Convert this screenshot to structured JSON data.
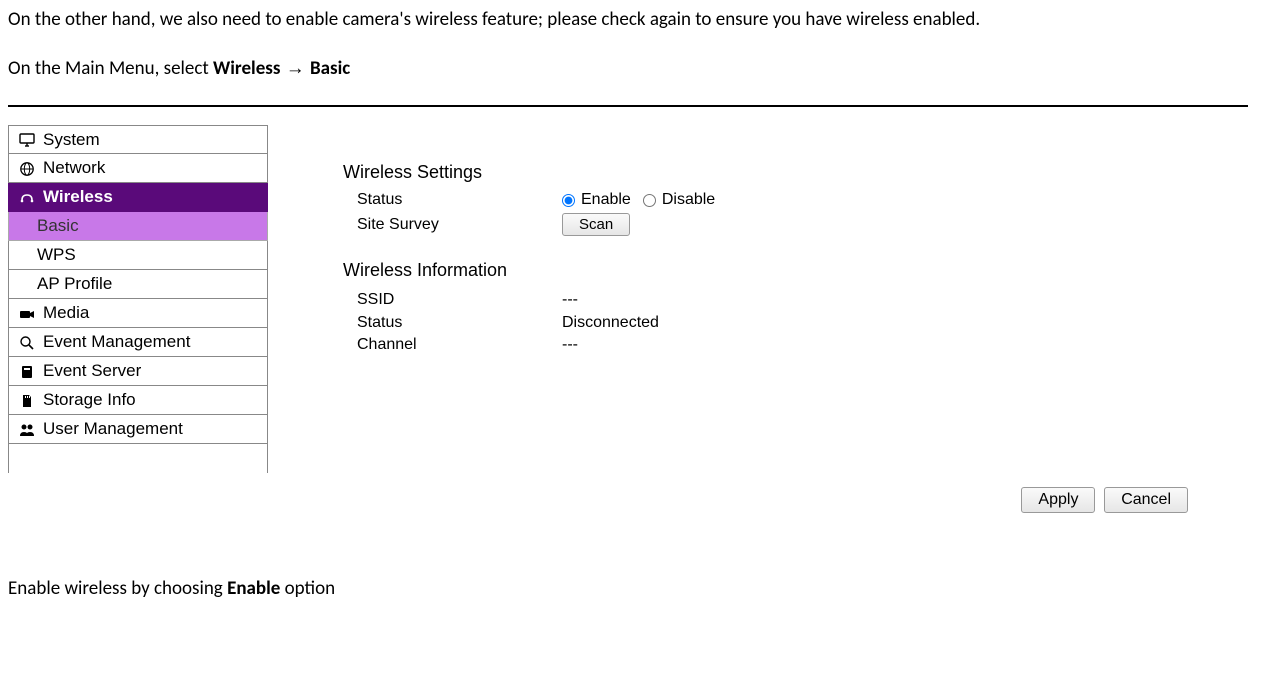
{
  "doc": {
    "para1": "On the other hand, we also need to enable camera's wireless feature; please check again to ensure you have wireless enabled.",
    "para2_prefix": "On the Main Menu, select ",
    "para2_bold1": "Wireless",
    "para2_arrow": " → ",
    "para2_bold2": "Basic",
    "para3_prefix": "Enable wireless by choosing ",
    "para3_bold": "Enable",
    "para3_suffix": " option"
  },
  "sidebar": {
    "items": [
      {
        "label": "System"
      },
      {
        "label": "Network"
      },
      {
        "label": "Wireless"
      },
      {
        "label": "Basic"
      },
      {
        "label": "WPS"
      },
      {
        "label": "AP Profile"
      },
      {
        "label": "Media"
      },
      {
        "label": "Event Management"
      },
      {
        "label": "Event Server"
      },
      {
        "label": "Storage Info"
      },
      {
        "label": "User Management"
      }
    ]
  },
  "content": {
    "settings_title": "Wireless Settings",
    "status_label": "Status",
    "enable_label": "Enable",
    "disable_label": "Disable",
    "survey_label": "Site Survey",
    "scan_btn": "Scan",
    "info_title": "Wireless Information",
    "ssid_label": "SSID",
    "ssid_value": "---",
    "status2_label": "Status",
    "status2_value": "Disconnected",
    "channel_label": "Channel",
    "channel_value": "---",
    "apply_btn": "Apply",
    "cancel_btn": "Cancel"
  }
}
